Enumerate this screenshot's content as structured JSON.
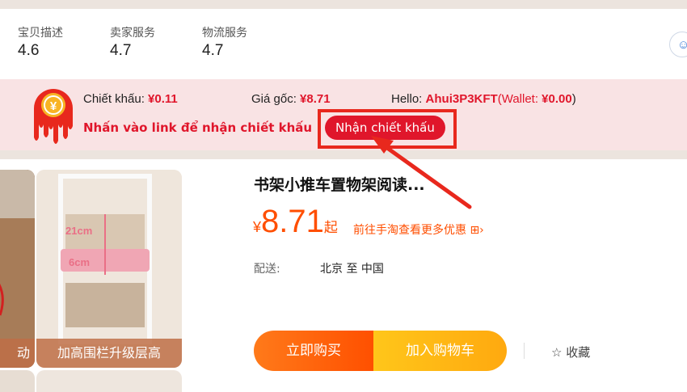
{
  "ratings": [
    {
      "label": "宝贝描述",
      "value": "4.6"
    },
    {
      "label": "卖家服务",
      "value": "4.7"
    },
    {
      "label": "物流服务",
      "value": "4.7"
    }
  ],
  "promo": {
    "discount_label": "Chiết khấu: ",
    "discount_value": "¥0.11",
    "original_label": "Giá gốc: ",
    "original_value": "¥8.71",
    "hello_label": "Hello: ",
    "username": "Ahui3P3KFT",
    "wallet_open": "(Wallet: ",
    "wallet_value": "¥0.00",
    "wallet_close": ")",
    "instruction": "Nhấn vào link để nhận chiết khấu",
    "button": "Nhận chiết khấu",
    "logo_glyph": "¥"
  },
  "gallery": {
    "caption_left": "动",
    "caption_main": "加高围栏升级层高",
    "dim_top": "21cm",
    "dim_bottom": "6cm"
  },
  "product": {
    "title": "书架小推车置物架阅读...",
    "currency": "¥",
    "price": "8.71",
    "price_suffix": "起",
    "more_offers": "前往手淘查看更多优惠 ⊞›",
    "shipping_label": "配送:",
    "shipping_value": "北京 至 中国"
  },
  "actions": {
    "buy_now": "立即购买",
    "add_to_cart": "加入购物车",
    "favorite": "☆ 收藏"
  },
  "colors": {
    "accent_red": "#e0162b",
    "price_orange": "#ff4e00",
    "promo_bg": "#f9e3e4"
  }
}
